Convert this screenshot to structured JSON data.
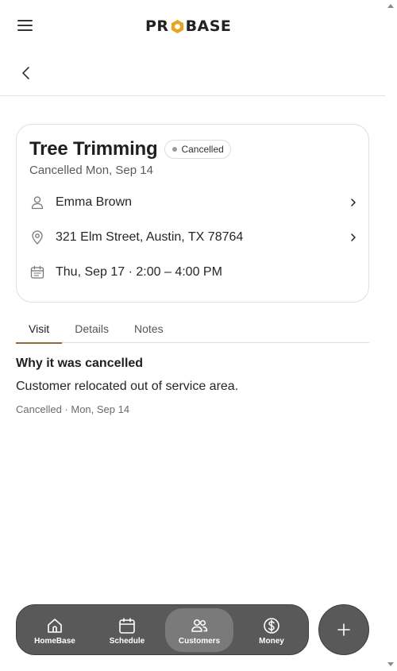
{
  "header": {
    "logo_text_left": "PR",
    "logo_text_right": "BASE"
  },
  "job": {
    "title": "Tree Trimming",
    "status": "Cancelled",
    "subtitle": "Cancelled Mon, Sep 14",
    "customer": "Emma Brown",
    "address": "321 Elm Street, Austin, TX 78764",
    "schedule": "Thu, Sep 17 · 2:00 – 4:00 PM"
  },
  "tabs": [
    {
      "label": "Visit",
      "active": true
    },
    {
      "label": "Details",
      "active": false
    },
    {
      "label": "Notes",
      "active": false
    }
  ],
  "visit": {
    "heading": "Why it was cancelled",
    "reason": "Customer relocated out of service area.",
    "meta": "Cancelled · Mon, Sep 14"
  },
  "bottom_nav": [
    {
      "label": "HomeBase",
      "icon": "home-icon",
      "active": false
    },
    {
      "label": "Schedule",
      "icon": "calendar-icon",
      "active": false
    },
    {
      "label": "Customers",
      "icon": "users-icon",
      "active": true
    },
    {
      "label": "Money",
      "icon": "dollar-icon",
      "active": false
    }
  ],
  "colors": {
    "accent": "#8b6d34",
    "logo_hex": "#e7a520",
    "nav_bg": "#595959"
  }
}
